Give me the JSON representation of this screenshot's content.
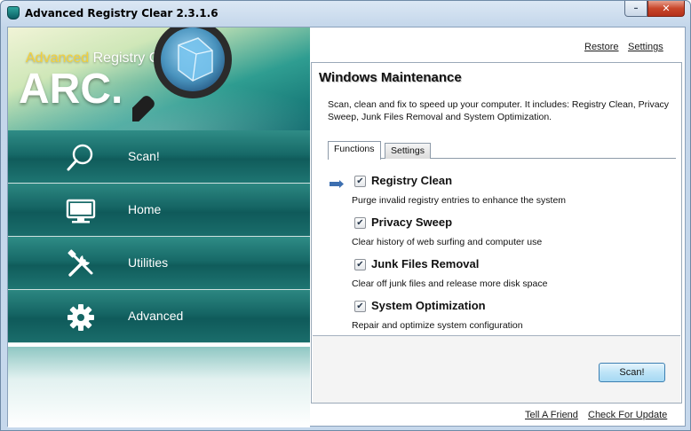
{
  "window": {
    "title": "Advanced Registry Clear  2.3.1.6",
    "minimize_glyph": "–",
    "close_glyph": "✕"
  },
  "brand": {
    "name_highlight": "Advanced",
    "name_rest": " Registry Clear",
    "abbr": "ARC.",
    "logo_icon": "magnifier-icon"
  },
  "nav": {
    "items": [
      {
        "label": "Scan!",
        "icon": "search-icon"
      },
      {
        "label": "Home",
        "icon": "monitor-icon"
      },
      {
        "label": "Utilities",
        "icon": "tools-icon"
      },
      {
        "label": "Advanced",
        "icon": "gear-icon"
      }
    ]
  },
  "header_links": {
    "restore": "Restore",
    "settings": "Settings"
  },
  "main": {
    "title": "Windows Maintenance",
    "description": "Scan, clean and fix to speed up your computer. It includes: Registry Clean, Privacy Sweep, Junk Files Removal and System Optimization.",
    "tabs": [
      {
        "label": "Functions",
        "active": true
      },
      {
        "label": "Settings",
        "active": false
      }
    ],
    "functions": [
      {
        "name": "Registry Clean",
        "desc": "Purge invalid registry entries to enhance the system",
        "checked": true,
        "selected": true
      },
      {
        "name": "Privacy Sweep",
        "desc": "Clear history of web surfing and computer use",
        "checked": true,
        "selected": false
      },
      {
        "name": "Junk Files Removal",
        "desc": "Clear off junk files and release more disk space",
        "checked": true,
        "selected": false
      },
      {
        "name": "System Optimization",
        "desc": "Repair and optimize system configuration",
        "checked": true,
        "selected": false
      }
    ],
    "check_glyph": "✔",
    "scan_button": "Scan!"
  },
  "footer_links": {
    "tell_friend": "Tell A Friend",
    "check_update": "Check For Update"
  },
  "colors": {
    "nav_teal": "#156564",
    "accent_blue": "#3c7fb1",
    "brand_yellow": "#f4d13a"
  }
}
